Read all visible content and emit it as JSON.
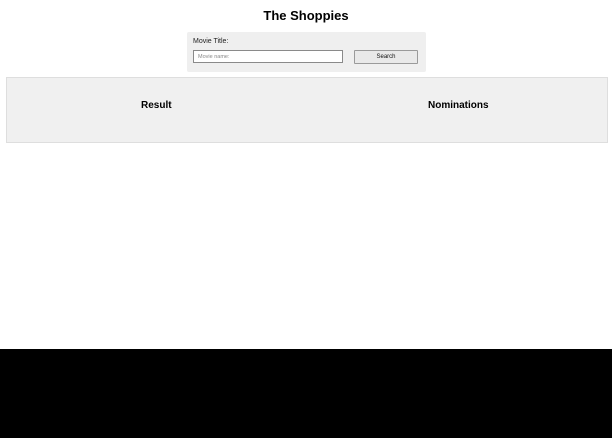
{
  "app": {
    "title": "The Shoppies"
  },
  "search": {
    "label": "Movie Title:",
    "placeholder": "Movie name:",
    "value": "",
    "button_label": "Search"
  },
  "results": {
    "result_heading": "Result",
    "nominations_heading": "Nominations"
  }
}
